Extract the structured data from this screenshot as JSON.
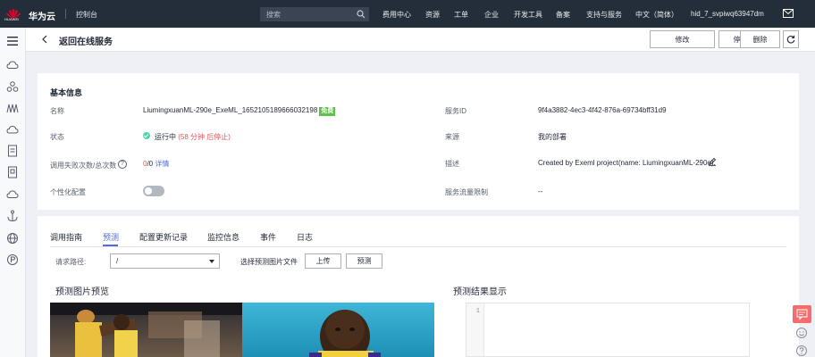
{
  "topbar": {
    "logo_text": "HUAWEI",
    "brand": "华为云",
    "console": "控制台",
    "search_placeholder": "搜索",
    "nav": [
      "费用中心",
      "资源",
      "工单",
      "企业",
      "开发工具",
      "备案",
      "支持与服务",
      "中文（简体）",
      "hid_7_svpiwq63947dm"
    ],
    "colors": {
      "bg": "#242e3b",
      "logo_red": "#e4002b"
    }
  },
  "sidebar": {
    "icons": [
      "menu-icon",
      "cloud-icon",
      "nodes-icon",
      "model-icon",
      "cloud-deploy-icon",
      "file-icon",
      "book-icon",
      "cloud-alt-icon",
      "anchor-icon",
      "globe-icon",
      "circle-p-icon"
    ]
  },
  "header": {
    "title": "返回在线服务",
    "buttons": {
      "edit": "修改",
      "stop": "停止",
      "delete": "删除"
    }
  },
  "basic_info": {
    "title": "基本信息",
    "name_label": "名称",
    "name_value": "LiumingxuanML-290e_ExeML_1652105189666032198",
    "free_badge": "免费",
    "status_label": "状态",
    "status_value": "运行中",
    "status_note": "(58 分钟 后停止)",
    "calls_label": "调用失败次数/总次数",
    "calls_fail": "0",
    "calls_total": "/0",
    "calls_detail": "详情",
    "custom_label": "个性化配置",
    "service_id_label": "服务ID",
    "service_id_value": "9f4a3882-4ec3-4f42-876a-69734bff31d9",
    "source_label": "来源",
    "source_value": "我的部署",
    "desc_label": "描述",
    "desc_value": "Created by Exeml project(name: LiumingxuanML-290e).",
    "traffic_label": "服务流量限制",
    "traffic_value": "--",
    "colors": {
      "status_ok": "#50d4ab",
      "badge": "#5ec04a",
      "warn": "#e0585c",
      "link": "#526ecc"
    }
  },
  "tabs": {
    "items": [
      "调用指南",
      "预测",
      "配置更新记录",
      "监控信息",
      "事件",
      "日志"
    ],
    "active": "预测"
  },
  "predict": {
    "path_label": "请求路径:",
    "path_value": "/",
    "choose_file_label": "选择预测图片文件",
    "upload_button": "上传",
    "predict_button": "预测",
    "preview_title": "预测图片预览",
    "result_title": "预测结果显示",
    "line_number": "1"
  }
}
